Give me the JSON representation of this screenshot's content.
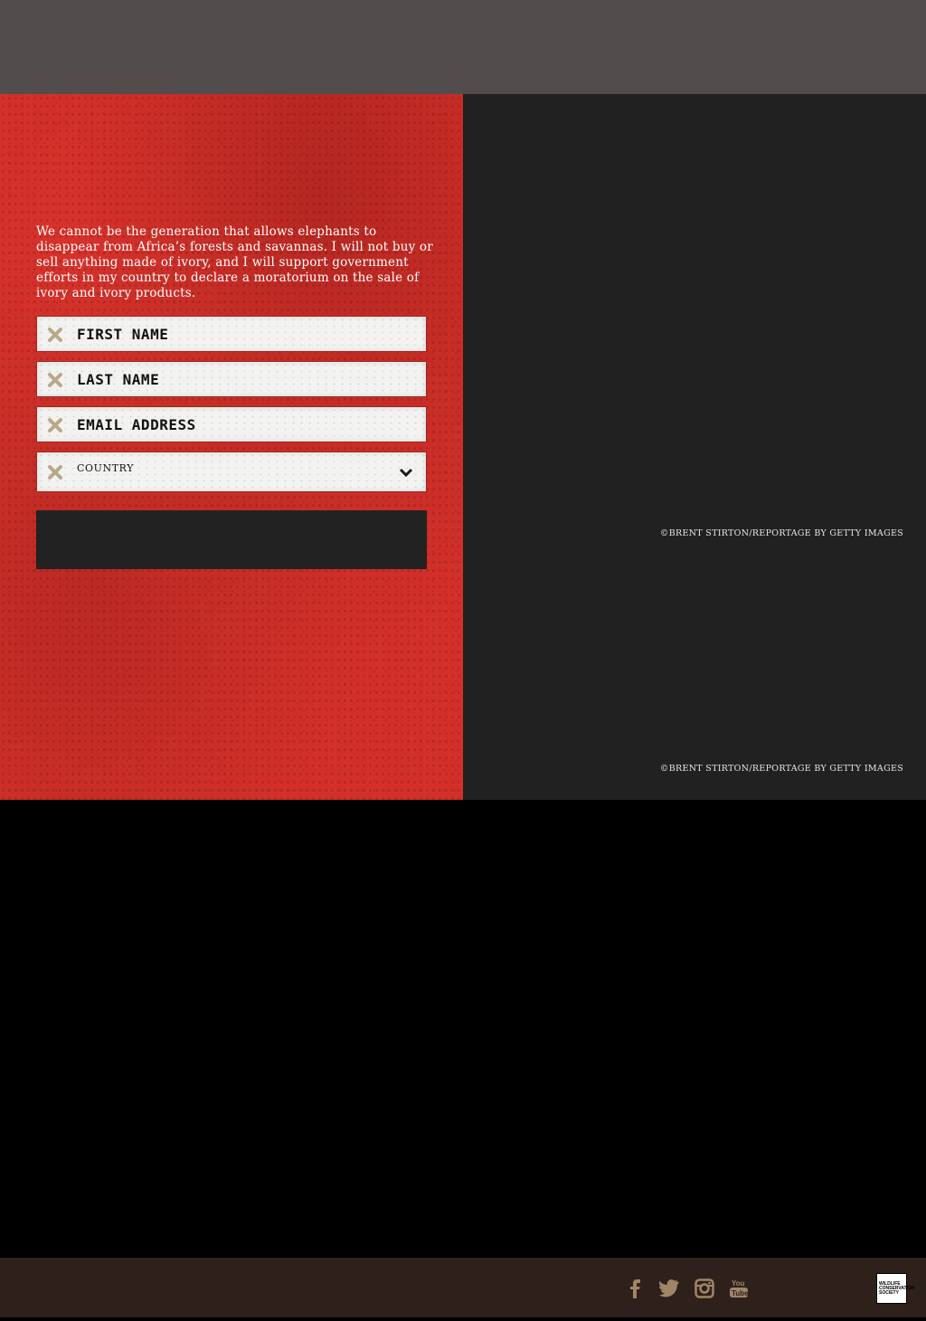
{
  "pledge": {
    "text": "We cannot be the generation that allows elephants to disappear from Africa’s forests and savannas. I will not buy or sell anything made of ivory, and I will support government efforts in my country to declare a moratorium on the sale of ivory and ivory products."
  },
  "form": {
    "first_name": "FIRST NAME",
    "last_name": "LAST NAME",
    "email": "EMAIL ADDRESS",
    "country": "COUNTRY"
  },
  "credits": {
    "photo1": "©BRENT STIRTON/REPORTAGE BY GETTY IMAGES",
    "photo2": "©BRENT STIRTON/REPORTAGE BY GETTY IMAGES"
  },
  "footer": {
    "social": [
      "facebook-icon",
      "twitter-icon",
      "instagram-icon",
      "youtube-icon"
    ],
    "logo": [
      "WILDLIFE",
      "CONSERVATION",
      "SOCIETY"
    ]
  },
  "colors": {
    "topbar": "#524c4c",
    "red_panel": "#d4302a",
    "dark_panel": "#222121",
    "footer": "#2e211c",
    "icon_tan": "#a08666",
    "x_icon": "#b8a88a"
  }
}
